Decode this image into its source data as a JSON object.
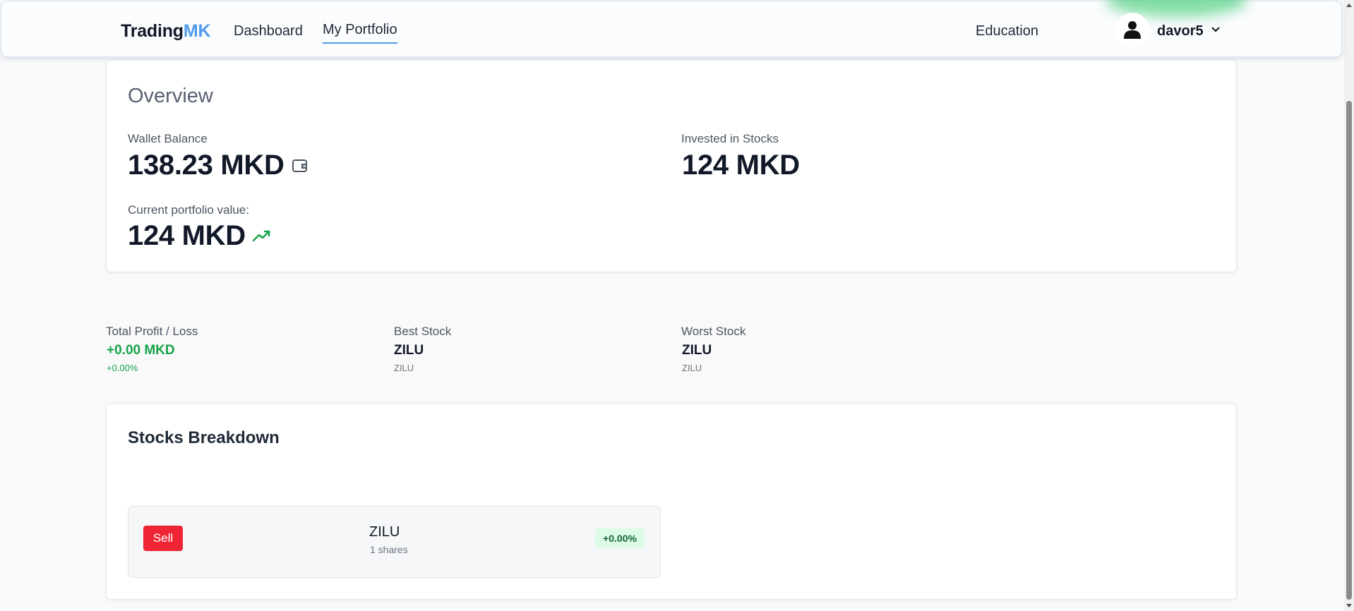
{
  "nav": {
    "brand_main": "Trading",
    "brand_accent": "MK",
    "links": {
      "dashboard": "Dashboard",
      "portfolio": "My Portfolio",
      "education": "Education"
    },
    "active": "My Portfolio",
    "user": {
      "name": "davor5",
      "avatar_icon": "user-icon",
      "menu_icon": "chevron-down-icon"
    }
  },
  "overview": {
    "title": "Overview",
    "wallet_label": "Wallet Balance",
    "wallet_value": "138.23 MKD",
    "wallet_icon": "wallet-icon",
    "invested_label": "Invested in Stocks",
    "invested_value": "124 MKD",
    "portfolio_label": "Current portfolio value:",
    "portfolio_value": "124 MKD",
    "portfolio_icon": "trending-up-icon"
  },
  "stats": {
    "profit": {
      "label": "Total Profit / Loss",
      "value": "+0.00 MKD",
      "sub": "+0.00%"
    },
    "best": {
      "label": "Best Stock",
      "value": "ZILU",
      "sub": "ZILU"
    },
    "worst": {
      "label": "Worst Stock",
      "value": "ZILU",
      "sub": "ZILU"
    }
  },
  "breakdown": {
    "title": "Stocks Breakdown",
    "items": [
      {
        "sell_label": "Sell",
        "symbol": "ZILU",
        "shares": "1 shares",
        "change": "+0.00%"
      }
    ]
  },
  "colors": {
    "accent": "#4f9bec",
    "positive": "#16a34a",
    "sell": "#ef2435",
    "badge_bg": "#dcfce7"
  }
}
